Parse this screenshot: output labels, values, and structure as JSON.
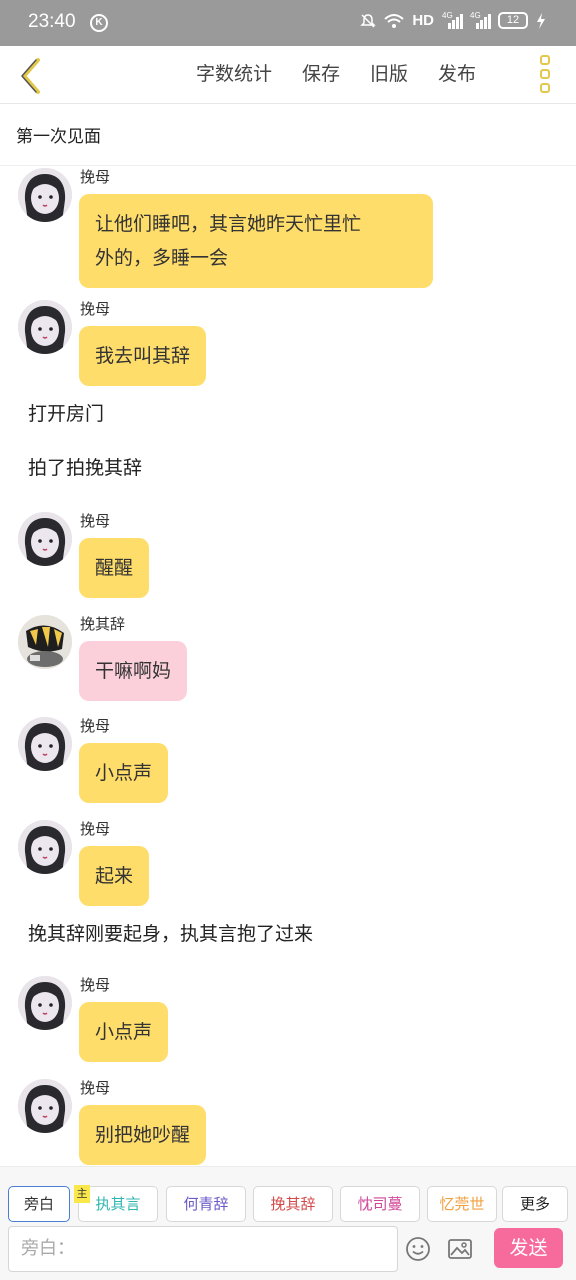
{
  "status": {
    "time": "23:40",
    "k_badge": "K",
    "network": "HD",
    "sig1": "4G",
    "sig2": "4G",
    "battery": "12"
  },
  "header": {
    "menu": [
      "字数统计",
      "保存",
      "旧版",
      "发布"
    ]
  },
  "story_title": "第一次见面",
  "messages": [
    {
      "type": "chat",
      "name": "挽母",
      "avatar": "mother",
      "text_lines": [
        "让他们睡吧，其言她昨天忙里忙",
        "外的，多睡一会"
      ],
      "color": "yellow"
    },
    {
      "type": "chat",
      "name": "挽母",
      "avatar": "mother",
      "text_lines": [
        "我去叫其辞"
      ],
      "color": "yellow"
    },
    {
      "type": "narration",
      "text": "打开房门"
    },
    {
      "type": "narration",
      "text": "拍了拍挽其辞"
    },
    {
      "type": "chat",
      "name": "挽母",
      "avatar": "mother",
      "text_lines": [
        "醒醒"
      ],
      "color": "yellow"
    },
    {
      "type": "chat",
      "name": "挽其辞",
      "avatar": "son",
      "text_lines": [
        "干嘛啊妈"
      ],
      "color": "pink"
    },
    {
      "type": "chat",
      "name": "挽母",
      "avatar": "mother",
      "text_lines": [
        "小点声"
      ],
      "color": "yellow"
    },
    {
      "type": "chat",
      "name": "挽母",
      "avatar": "mother",
      "text_lines": [
        "起来"
      ],
      "color": "yellow"
    },
    {
      "type": "narration",
      "text": "挽其辞刚要起身，执其言抱了过来"
    },
    {
      "type": "chat",
      "name": "挽母",
      "avatar": "mother",
      "text_lines": [
        "小点声"
      ],
      "color": "yellow"
    },
    {
      "type": "chat",
      "name": "挽母",
      "avatar": "mother",
      "text_lines": [
        "别把她吵醒"
      ],
      "color": "yellow"
    }
  ],
  "characters": {
    "main_badge": "主",
    "tabs": [
      {
        "label": "旁白",
        "color": "#333333"
      },
      {
        "label": "执其言",
        "color": "#2fb6b0"
      },
      {
        "label": "何青辞",
        "color": "#6a5ac8"
      },
      {
        "label": "挽其辞",
        "color": "#d44a4a"
      },
      {
        "label": "忱司蔓",
        "color": "#d0479a"
      },
      {
        "label": "忆莞世",
        "color": "#f0a040"
      },
      {
        "label": "更多",
        "color": "#333333"
      }
    ]
  },
  "input": {
    "placeholder": "旁白：",
    "send_label": "发送"
  }
}
